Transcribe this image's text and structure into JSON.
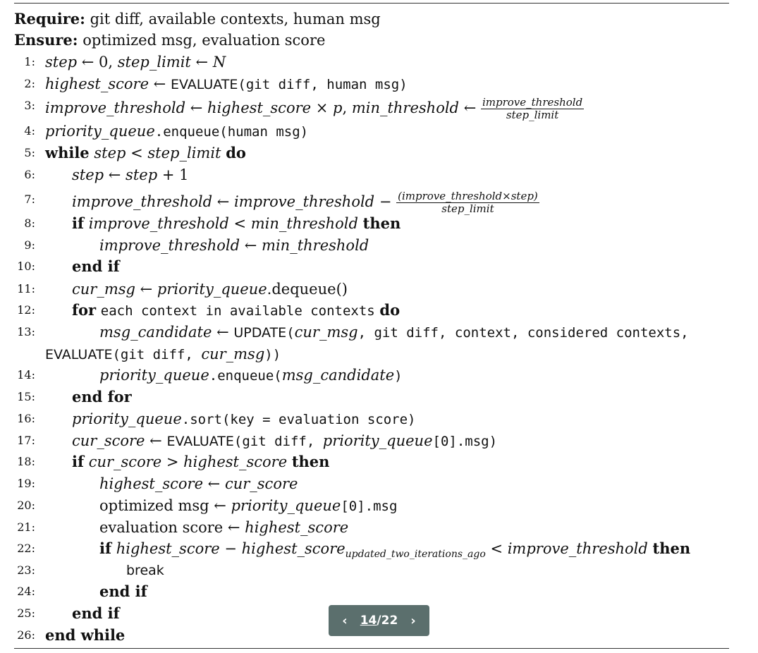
{
  "require": {
    "label": "Require:",
    "text": "git diff, available contexts, human msg"
  },
  "ensure": {
    "label": "Ensure:",
    "text": "optimized msg, evaluation score"
  },
  "line_numbers": [
    "1:",
    "2:",
    "3:",
    "4:",
    "5:",
    "6:",
    "7:",
    "8:",
    "9:",
    "10:",
    "11:",
    "12:",
    "13:",
    "14:",
    "15:",
    "16:",
    "17:",
    "18:",
    "19:",
    "20:",
    "21:",
    "22:",
    "23:",
    "24:",
    "25:",
    "26:"
  ],
  "kw": {
    "while": "while",
    "do": "do",
    "if": "if",
    "then": "then",
    "end_if": "end if",
    "for": "for",
    "end_for": "end for",
    "end_while": "end while",
    "break": "break"
  },
  "vars": {
    "step": "step",
    "step_limit": "step_limit",
    "N": "N",
    "zero": "0",
    "highest_score": "highest_score",
    "improve_threshold": "improve_threshold",
    "min_threshold": "min_threshold",
    "p": "p",
    "priority_queue": "priority_queue",
    "cur_msg": "cur_msg",
    "msg_candidate": "msg_candidate",
    "cur_score": "cur_score",
    "sub_two_iter": "updated_two_iterations_ago",
    "one": "1",
    "frac7_num": "(improve_threshold×step)"
  },
  "text": {
    "evaluate": "EVALUATE",
    "update": "UPDATE",
    "git_diff_human_msg": "(git diff, human msg)",
    "enqueue": ".enqueue",
    "human_msg_arg": "(human msg)",
    "dequeue": ".dequeue()",
    "for_each": "each context in available contexts",
    "update_args": ", git diff, context, considered contexts,",
    "git_diff_open": "(git diff, ",
    "sort_call": ".sort(key = evaluation score)",
    "pq0_msg": "[0].msg",
    "optimized_msg": "optimized msg",
    "evaluation_score": "evaluation score"
  },
  "pager": {
    "current": "14",
    "separator": "/",
    "total": "22"
  }
}
